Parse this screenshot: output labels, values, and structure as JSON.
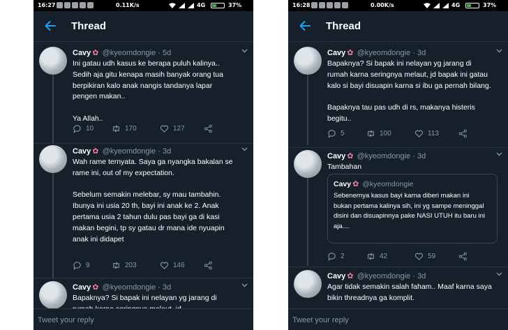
{
  "phones": [
    {
      "status": {
        "time": "16:27",
        "speed": "0.11K/s",
        "network": "4G",
        "battery": "37%",
        "battery_level": 0.37
      },
      "header": {
        "title": "Thread"
      },
      "tweets": [
        {
          "name": "Cavy",
          "handle": "@kyeomdongie",
          "dot": "·",
          "time": "5d",
          "text": "Ini gatau udh kasus ke berapa puluh kalinya.. Sedih aja gitu kenapa masih banyak orang tua berpikiran kalo anak nangis tandanya lapar pengen makan..\n\nYa Allah..",
          "replies": "10",
          "retweets": "170",
          "likes": "127"
        },
        {
          "name": "Cavy",
          "handle": "@kyeomdongie",
          "dot": "·",
          "time": "3d",
          "text": "Wah rame ternyata. Saya ga nyangka bakalan se rame ini, out of my expectation.\n\nSebelum semakin melebar, sy mau tambahin. Ibunya ini usia 20 th, bayi ini anak ke 2. Anak pertama usia 2 tahun dulu pas bayi ga di kasi makan begini, tp sy gatau dr mana ide nyuapin anak ini didapet",
          "replies": "9",
          "retweets": "203",
          "likes": "146"
        },
        {
          "name": "Cavy",
          "handle": "@kyeomdongie",
          "dot": "·",
          "time": "3d",
          "text": "Bapaknya? Si bapak ini nelayan yg jarang di rumah karna seringnya melaut, jd"
        }
      ],
      "reply_placeholder": "Tweet your reply"
    },
    {
      "status": {
        "time": "16:28",
        "speed": "0.00K/s",
        "network": "4G",
        "battery": "37%",
        "battery_level": 0.37
      },
      "header": {
        "title": "Thread"
      },
      "tweets": [
        {
          "name": "Cavy",
          "handle": "@kyeomdongie",
          "dot": "·",
          "time": "3d",
          "text": "Bapaknya? Si bapak ini nelayan yg jarang di rumah karna seringnya melaut, jd bapak ini gatau kalo si bayi disuapin karna si ibu ga pernah bilang.\n\nBapaknya tau pas udh di rs, makanya histeris begitu..",
          "replies": "5",
          "retweets": "100",
          "likes": "113"
        },
        {
          "name": "Cavy",
          "handle": "@kyeomdongie",
          "dot": "·",
          "time": "3d",
          "text": "Tambahan",
          "quote": {
            "name": "Cavy",
            "handle": "@kyeomdongie",
            "text": "Sebenernya kasus bayi karna diberi makan ini bukan pertama kalinya sih, ini yg sampe meninggal disini dan disuapinnya pake NASI UTUH itu baru ini aja...."
          },
          "replies": "2",
          "retweets": "42",
          "likes": "59"
        },
        {
          "name": "Cavy",
          "handle": "@kyeomdongie",
          "dot": "·",
          "time": "3d",
          "text": "Agar tidak semakin salah faham.. Maaf karna saya bikin threadnya ga komplit."
        }
      ],
      "reply_placeholder": "Tweet your reply"
    }
  ],
  "colors": {
    "background": "#15202b",
    "text": "#ffffff",
    "muted": "#8899a6",
    "accent": "#1da1f2",
    "flower": "#f27fa5"
  },
  "icons": {
    "back": "arrow-left-icon",
    "flower": "cherry-blossom-icon",
    "reply": "comment-icon",
    "retweet": "retweet-icon",
    "like": "heart-icon",
    "share": "share-icon",
    "more": "chevron-down-icon"
  }
}
